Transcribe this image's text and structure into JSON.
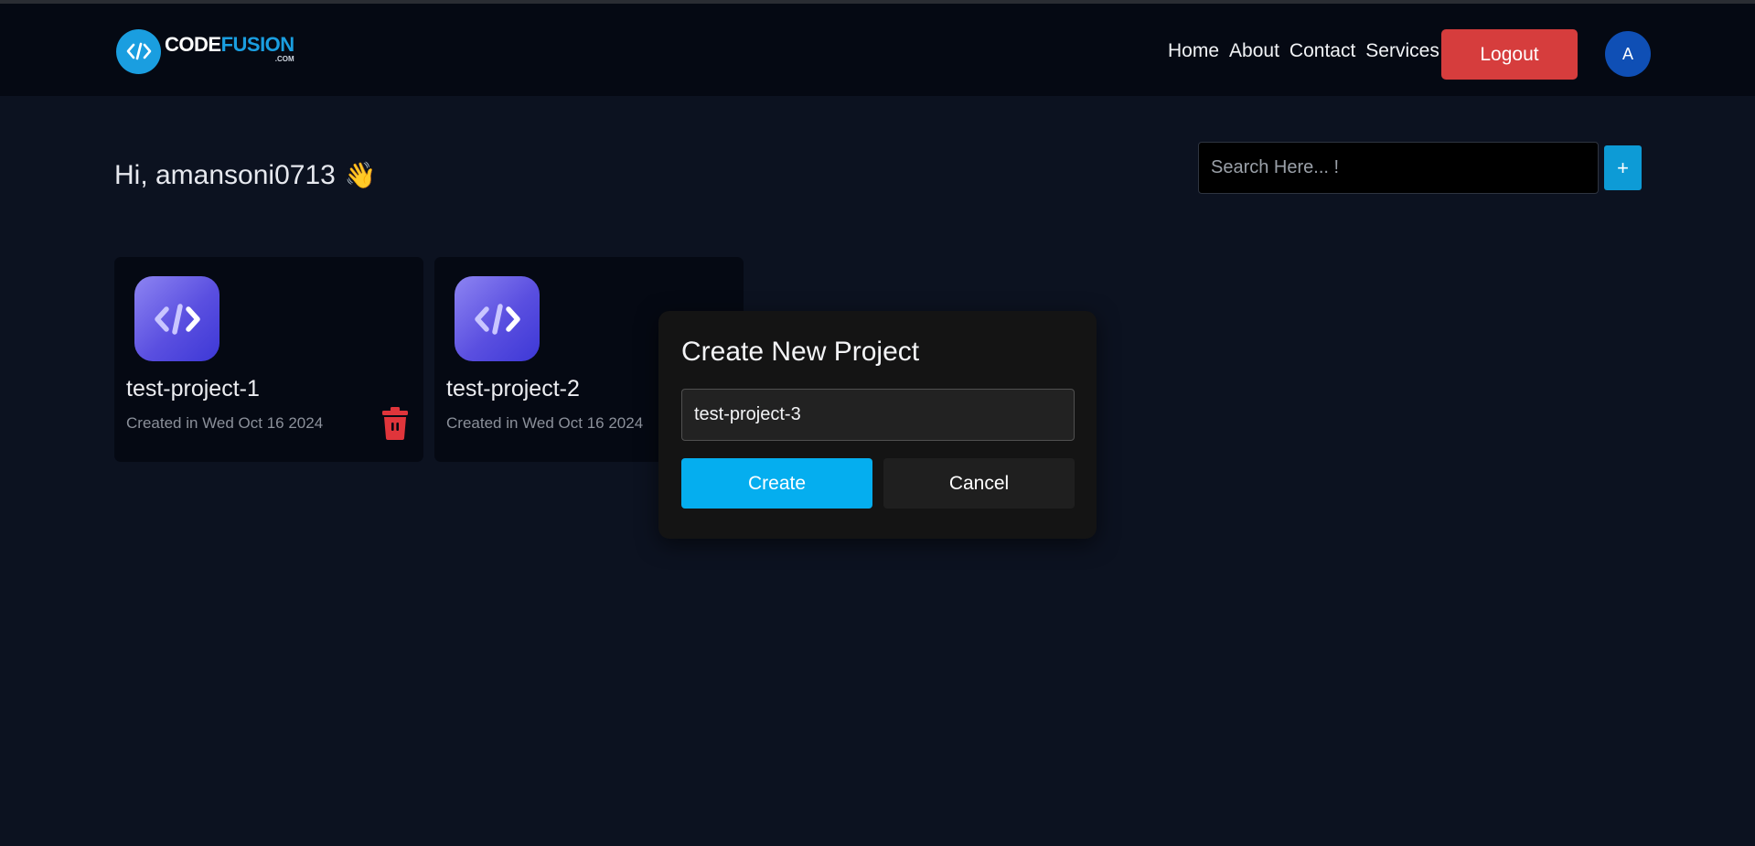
{
  "brand": {
    "word1": "CODE",
    "word2": "FUSION",
    "domain": ".COM",
    "icon": "code-brackets-icon"
  },
  "nav": {
    "links": [
      "Home",
      "About",
      "Contact",
      "Services"
    ],
    "logout_label": "Logout",
    "avatar_initial": "A"
  },
  "greeting": {
    "text": "Hi, amansoni0713",
    "emoji": "👋"
  },
  "search": {
    "placeholder": "Search Here... !",
    "value": "",
    "add_label": "+"
  },
  "projects": [
    {
      "name": "test-project-1",
      "created": "Created in Wed Oct 16 2024",
      "icon": "code-icon",
      "action_icon": "trash-icon"
    },
    {
      "name": "test-project-2",
      "created": "Created in Wed Oct 16 2024",
      "icon": "code-icon"
    }
  ],
  "modal": {
    "title": "Create New Project",
    "input_value": "test-project-3",
    "create_label": "Create",
    "cancel_label": "Cancel"
  },
  "colors": {
    "page_bg": "#0c1220",
    "navbar_bg": "#050913",
    "accent": "#05aeef",
    "logout": "#d63d3d",
    "avatar": "#0f4fb5"
  }
}
